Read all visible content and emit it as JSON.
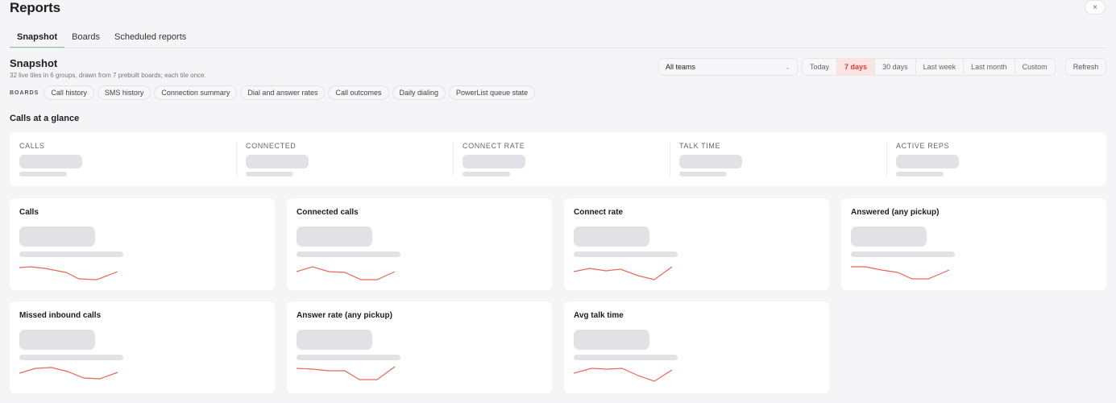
{
  "header": {
    "title": "Reports",
    "close_label": "×"
  },
  "tabs": [
    {
      "label": "Snapshot",
      "active": true
    },
    {
      "label": "Boards",
      "active": false
    },
    {
      "label": "Scheduled reports",
      "active": false
    }
  ],
  "snapshot": {
    "title": "Snapshot",
    "subtitle": "32 live tiles in 6 groups, drawn from 7 prebuilt boards; each tile once."
  },
  "filters": {
    "team": "All teams",
    "ranges": [
      {
        "label": "Today",
        "active": false
      },
      {
        "label": "7 days",
        "active": true
      },
      {
        "label": "30 days",
        "active": false
      },
      {
        "label": "Last week",
        "active": false
      },
      {
        "label": "Last month",
        "active": false
      },
      {
        "label": "Custom",
        "active": false
      }
    ],
    "refresh_label": "Refresh"
  },
  "boards": {
    "label": "BOARDS",
    "items": [
      "Call history",
      "SMS history",
      "Connection summary",
      "Dial and answer rates",
      "Call outcomes",
      "Daily dialing",
      "PowerList queue state"
    ]
  },
  "group": {
    "title": "Calls at a glance",
    "kpis": [
      "CALLS",
      "CONNECTED",
      "CONNECT RATE",
      "TALK TIME",
      "ACTIVE REPS"
    ]
  },
  "tiles": [
    {
      "title": "Calls"
    },
    {
      "title": "Connected calls"
    },
    {
      "title": "Connect rate"
    },
    {
      "title": "Answered (any pickup)"
    },
    {
      "title": "Missed inbound calls"
    },
    {
      "title": "Answer rate (any pickup)"
    },
    {
      "title": "Avg talk time"
    }
  ],
  "colors": {
    "accent_tab": "#7fc1a0",
    "active_range": "#d2403a",
    "sparkline": "#e8675a",
    "skeleton": "#e2e2e6"
  }
}
